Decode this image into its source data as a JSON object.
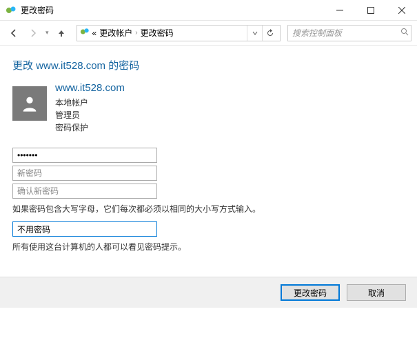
{
  "window": {
    "title": "更改密码"
  },
  "breadcrumb": {
    "level1": "更改帐户",
    "level2": "更改密码",
    "chevrons": "«"
  },
  "search": {
    "placeholder": "搜索控制面板"
  },
  "heading": {
    "prefix": "更改 ",
    "account": "www.it528.com",
    "suffix": " 的密码"
  },
  "user": {
    "name": "www.it528.com",
    "type": "本地帐户",
    "role": "管理员",
    "protection": "密码保护"
  },
  "fields": {
    "current_password_value": "•••••••",
    "new_password_placeholder": "新密码",
    "confirm_password_placeholder": "确认新密码",
    "case_hint": "如果密码包含大写字母，它们每次都必须以相同的大小写方式输入。",
    "hint_value": "不用密码",
    "hint_visible_note": "所有使用这台计算机的人都可以看见密码提示。"
  },
  "buttons": {
    "submit": "更改密码",
    "cancel": "取消"
  }
}
